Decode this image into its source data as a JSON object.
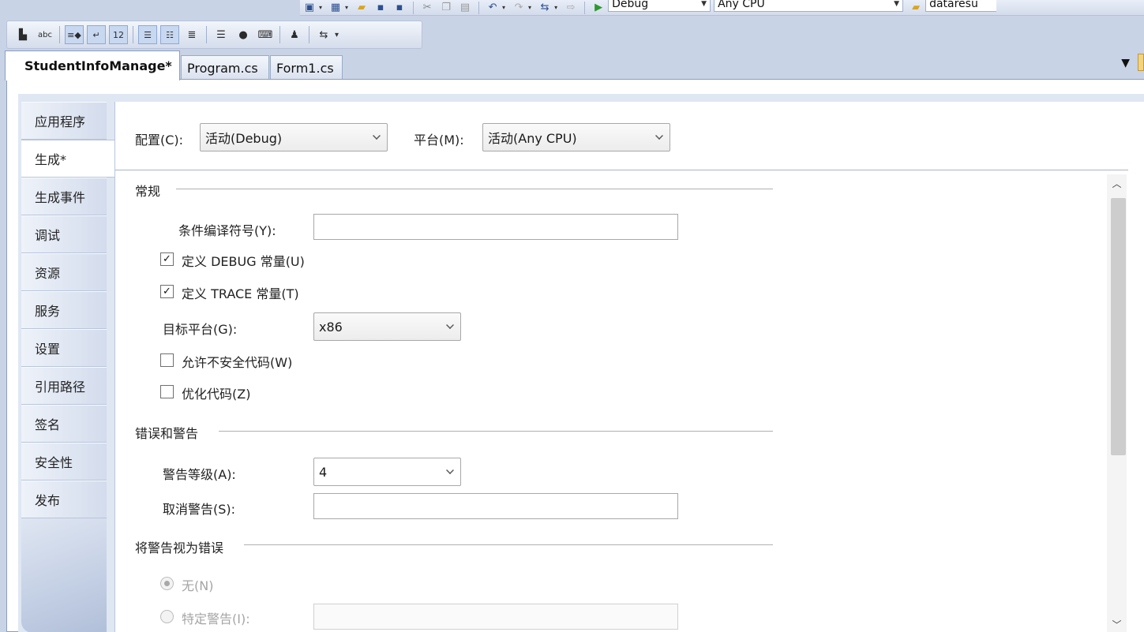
{
  "toolbar_top": {
    "config_value": "Debug",
    "platform_value": "Any CPU",
    "project_value": "dataresu"
  },
  "toolbar_second": {
    "icons": [
      "toggle-bookmark-icon",
      "spell-check-icon",
      "indent-icon",
      "wrap-icon",
      "number-icon",
      "outdent-left-icon",
      "outdent-right-icon",
      "align-icon",
      "comment-icon",
      "bubble-icon",
      "code-icon",
      "brush-icon",
      "format-icon"
    ]
  },
  "tabs": [
    {
      "label": "StudentInfoManage*",
      "active": true
    },
    {
      "label": "Program.cs",
      "active": false
    },
    {
      "label": "Form1.cs",
      "active": false
    }
  ],
  "sidebar": {
    "items": [
      {
        "label": "应用程序",
        "active": false
      },
      {
        "label": "生成*",
        "active": true
      },
      {
        "label": "生成事件",
        "active": false
      },
      {
        "label": "调试",
        "active": false
      },
      {
        "label": "资源",
        "active": false
      },
      {
        "label": "服务",
        "active": false
      },
      {
        "label": "设置",
        "active": false
      },
      {
        "label": "引用路径",
        "active": false
      },
      {
        "label": "签名",
        "active": false
      },
      {
        "label": "安全性",
        "active": false
      },
      {
        "label": "发布",
        "active": false
      }
    ]
  },
  "config_row": {
    "config_label": "配置(C):",
    "config_value": "活动(Debug)",
    "platform_label": "平台(M):",
    "platform_value": "活动(Any CPU)"
  },
  "general": {
    "title": "常规",
    "conditional_symbols_label": "条件编译符号(Y):",
    "conditional_symbols_value": "",
    "define_debug_label": "定义 DEBUG 常量(U)",
    "define_debug_checked": true,
    "define_trace_label": "定义 TRACE 常量(T)",
    "define_trace_checked": true,
    "target_platform_label": "目标平台(G):",
    "target_platform_value": "x86",
    "allow_unsafe_label": "允许不安全代码(W)",
    "allow_unsafe_checked": false,
    "optimize_label": "优化代码(Z)",
    "optimize_checked": false
  },
  "errors_warnings": {
    "title": "错误和警告",
    "warning_level_label": "警告等级(A):",
    "warning_level_value": "4",
    "suppress_label": "取消警告(S):",
    "suppress_value": ""
  },
  "treat_warnings": {
    "title": "将警告视为错误",
    "none_label": "无(N)",
    "none_selected": true,
    "specific_label": "特定警告(I):"
  },
  "glyphs": {
    "check": "✓",
    "dropdown": "▾",
    "scroll_up": "︿",
    "scroll_down": "﹀",
    "tab_menu": "▼"
  }
}
